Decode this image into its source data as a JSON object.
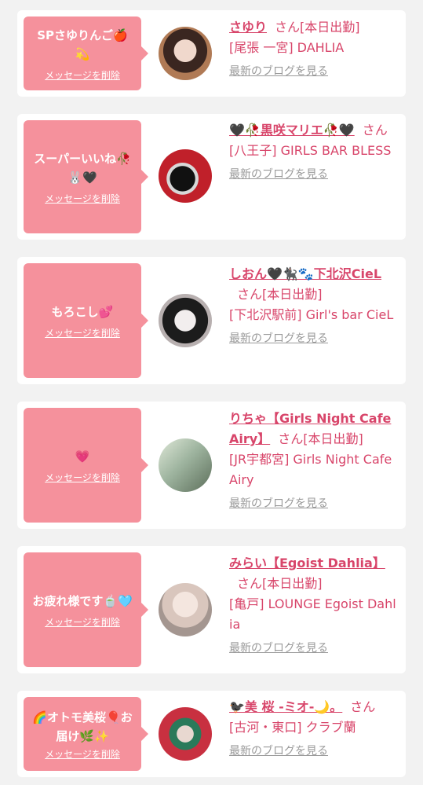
{
  "cards": [
    {
      "message": "SPさゆりんご🍎💫",
      "delete_label": "メッセージを削除",
      "name": "さゆり",
      "suffix": "さん",
      "status": "[本日出勤]",
      "shop": "[尾張 一宮] DAHLIA",
      "blog_label": "最新のブログを見る",
      "avatar_colors": [
        "#caa68a",
        "#5a3a2a"
      ]
    },
    {
      "message": "スーパーいいね🥀🐰🖤",
      "delete_label": "メッセージを削除",
      "name": "🖤🥀黒咲マリエ🥀🖤",
      "suffix": "さん",
      "status": "",
      "shop": "[八王子] GIRLS BAR BLESS",
      "blog_label": "最新のブログを見る",
      "avatar_colors": [
        "#c0202a",
        "#1a1a1a"
      ]
    },
    {
      "message": "もろこし💕",
      "delete_label": "メッセージを削除",
      "name": "しおん🖤🐈‍⬛🐾下北沢CieL",
      "suffix": "さん",
      "status": "[本日出勤]",
      "shop": "[下北沢駅前] Girl's bar CieL",
      "blog_label": "最新のブログを見る",
      "avatar_colors": [
        "#d8d0d0",
        "#222222"
      ]
    },
    {
      "message": "💗",
      "delete_label": "メッセージを削除",
      "name": "りちゃ【Girls Night Cafe Airy】",
      "suffix": "さん",
      "status": "[本日出勤]",
      "shop": "[JR宇都宮] Girls Night Cafe Airy",
      "blog_label": "最新のブログを見る",
      "avatar_colors": [
        "#b8cbb0",
        "#6d8a72"
      ]
    },
    {
      "message": "お疲れ様です🍵🩵",
      "delete_label": "メッセージを削除",
      "name": "みらい【Egoist Dahlia】",
      "suffix": "さん",
      "status": "[本日出勤]",
      "shop": "[亀戸] LOUNGE Egoist Dahlia",
      "blog_label": "最新のブログを見る",
      "avatar_colors": [
        "#e8dcd6",
        "#9a8a86"
      ]
    },
    {
      "message": "🌈オトモ美桜🎈お届け🌿✨",
      "delete_label": "メッセージを削除",
      "name": "🐦‍⬛美 桜 -ミオ-🌙。",
      "suffix": "さん",
      "status": "",
      "shop": "[古河・東口] クラブ蘭",
      "blog_label": "最新のブログを見る",
      "avatar_colors": [
        "#c83040",
        "#2a7a5a"
      ]
    }
  ]
}
